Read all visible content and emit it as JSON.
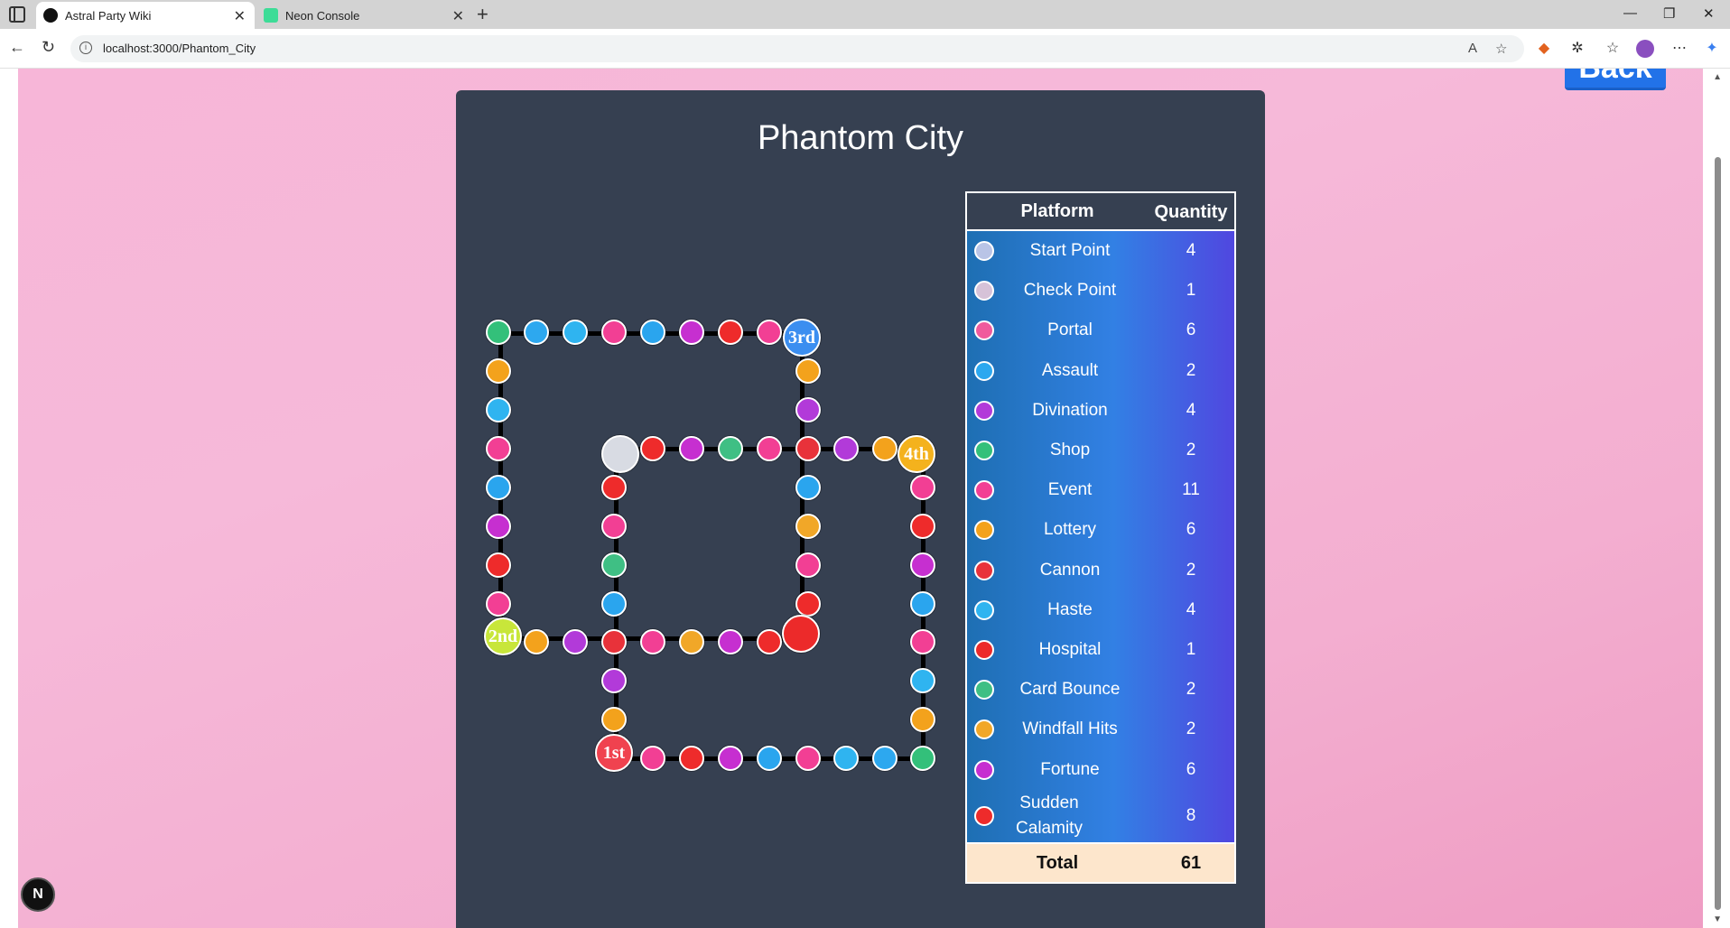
{
  "browser": {
    "tabs": [
      {
        "label": "Astral Party Wiki",
        "active": true
      },
      {
        "label": "Neon Console",
        "active": false
      }
    ],
    "url": "localhost:3000/Phantom_City"
  },
  "page": {
    "back_label": "Back",
    "title": "Phantom City",
    "n_badge": "N"
  },
  "colors": {
    "start": "#3b8ef0",
    "checkpoint": "#d8dbe3",
    "portal": "#2aa5ee",
    "assault": "#2da8ef",
    "divination": "#b23ad9",
    "shop": "#33c07a",
    "event": "#f23f94",
    "lottery": "#f3a21c",
    "cannon": "#e8323a",
    "haste": "#2fb4f0",
    "hospital": "#ec2a2a",
    "card_bounce": "#3fbf84",
    "windfall": "#f1a728",
    "fortune": "#c62fd0",
    "calamity": "#ee2b2b"
  },
  "table": {
    "headers": {
      "platform": "Platform",
      "quantity": "Quantity"
    },
    "rows": [
      {
        "name": "Start Point",
        "qty": "4",
        "color": "#b9c4e6"
      },
      {
        "name": "Check Point",
        "qty": "1",
        "color": "#d6c2d8"
      },
      {
        "name": "Portal",
        "qty": "6",
        "color": "#f05a9c"
      },
      {
        "name": "Assault",
        "qty": "2",
        "color": "#2da8ef"
      },
      {
        "name": "Divination",
        "qty": "4",
        "color": "#b23ad9"
      },
      {
        "name": "Shop",
        "qty": "2",
        "color": "#33c07a"
      },
      {
        "name": "Event",
        "qty": "11",
        "color": "#f23f94"
      },
      {
        "name": "Lottery",
        "qty": "6",
        "color": "#f3a21c"
      },
      {
        "name": "Cannon",
        "qty": "2",
        "color": "#e8323a"
      },
      {
        "name": "Haste",
        "qty": "4",
        "color": "#2fb4f0"
      },
      {
        "name": "Hospital",
        "qty": "1",
        "color": "#ec2a2a"
      },
      {
        "name": "Card Bounce",
        "qty": "2",
        "color": "#3fbf84"
      },
      {
        "name": "Windfall Hits",
        "qty": "2",
        "color": "#f1a728"
      },
      {
        "name": "Fortune",
        "qty": "6",
        "color": "#c62fd0"
      },
      {
        "name": "Sudden Calamity",
        "qty": "8",
        "color": "#ee2b2b"
      }
    ],
    "total_label": "Total",
    "total_value": "61"
  },
  "board": {
    "start_labels": [
      "1st",
      "2nd",
      "3rd",
      "4th"
    ]
  }
}
